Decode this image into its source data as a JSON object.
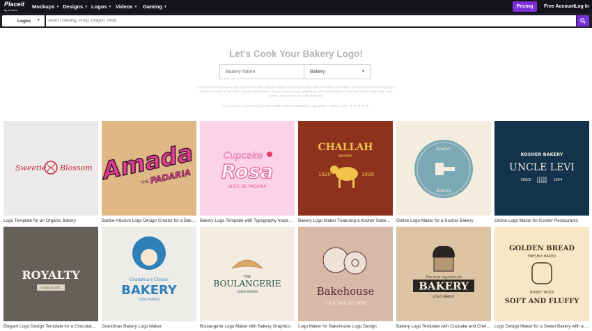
{
  "nav": {
    "logo_text": "Placeit",
    "logo_sub": "by envato",
    "items": [
      {
        "label": "Mockups"
      },
      {
        "label": "Designs"
      },
      {
        "label": "Logos"
      },
      {
        "label": "Videos"
      },
      {
        "label": "Gaming"
      }
    ],
    "pricing_label": "Pricing",
    "free_account_label": "Free Account",
    "login_label": "Log In"
  },
  "search": {
    "category": "Logos",
    "placeholder": "Search Gaming, Pubg, Dragon, Skull...",
    "icon": "search-icon"
  },
  "hero": {
    "title": "Let's Cook Your Bakery Logo!",
    "name_placeholder": "Bakery Name",
    "type_value": "Bakery",
    "description": "Create an amazing bakery logo in just a few clicks using the easiest online logo maker! Placeit's Bakery Logo Maker has tons of beautiful designs you can use to create a logo that is unique to your bakery. Simply choose a logo template you like and customize it with your brand's name, your color palette, and an icon. It's really that easy!",
    "quote": "\"Look how we reinvented a logo that is made with Placeit's Bakery Logo Maker\" - Rating: 4.5/5",
    "stars": "★★★★★"
  },
  "colors": {
    "accent": "#7b2fd8",
    "nav_bg": "#14141a",
    "search_bg": "#1e1e26"
  },
  "grid": {
    "row1": [
      {
        "caption": "Logo Template for an Organic Bakery",
        "text1": "Sweetie",
        "text2": "Blossom"
      },
      {
        "caption": "Barbie-Allusive Logo Design Creator for a Bakery",
        "text1": "Amada",
        "text2": "PADARIA",
        "text3": "THE"
      },
      {
        "caption": "Bakery Logo Template with Typography Inspired by Pink Aesthetic",
        "text1": "Cupcake",
        "text2": "Rosa",
        "text3": "VLOG DE PADARIA"
      },
      {
        "caption": "Bakery Logo Maker Featuring a Kosher Statement",
        "text1": "CHALLAH",
        "text2": "BAKERY",
        "text3": "1920",
        "text4": "1999"
      },
      {
        "caption": "Online Logo Maker for a Kosher Bakery",
        "text1": "Kosher",
        "text2": "Bakery"
      },
      {
        "caption": "Online Logo Maker for Kosher Restaurants",
        "text1": "KOSHER BAKERY",
        "text2": "UNCLE LEVI",
        "text3": "SINCE",
        "text4": "1954"
      }
    ],
    "row2": [
      {
        "caption": "Elegant Logo Design Template for a Chocolate Company",
        "text1": "ROYALTY",
        "text2": "CHOCOLATE"
      },
      {
        "caption": "Grandmas Bakery Logo Maker",
        "text1": "Grandma's Choice",
        "text2": "BAKERY",
        "text3": "LOGO MAKER"
      },
      {
        "caption": "Boulangerie Logo Maker with Bakery Graphics",
        "text1": "THE",
        "text2": "BOULANGERIE",
        "text3": "LOGO MAKER"
      },
      {
        "caption": "Logo Maker for Bakehouse Logo Design",
        "text1": "Bakehouse",
        "text2": "YOUR TAGLINE HERE"
      },
      {
        "caption": "Bakery Logo Template with Cupcake and Chef Graphics",
        "text1": "The best ingredients",
        "text2": "BAKERY",
        "text3": "LOGO MAKER"
      },
      {
        "caption": "Logo Design Maker for a Sweet Bakery with a Bread Graphic",
        "text1": "GOLDEN BREAD",
        "text2": "FRESHLY BAKED",
        "text3": "HONEY TASTE",
        "text4": "SOFT AND FLUFFY"
      }
    ]
  }
}
